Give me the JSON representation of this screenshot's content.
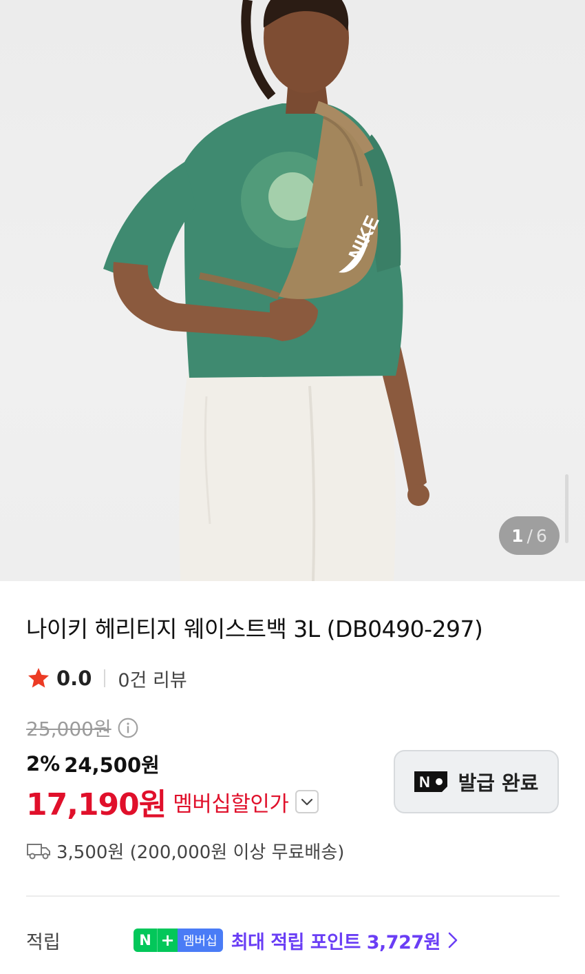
{
  "gallery": {
    "current_page": "1",
    "separator": "/",
    "total_pages": "6"
  },
  "product": {
    "title": "나이키 헤리티지 웨이스트백 3L (DB0490-297)",
    "rating": "0.0",
    "review_count": "0건 리뷰",
    "original_price": "25,000원",
    "sale_rate": "2%",
    "sale_price": "24,500원",
    "member_price": "17,190원",
    "member_price_label": "멤버십할인가",
    "coupon_button_label": "발급 완료",
    "shipping": "3,500원 (200,000원 이상 무료배송)"
  },
  "points": {
    "label": "적립",
    "badge_n": "N",
    "badge_plus": "+",
    "badge_text": "멤버십",
    "text": "최대 적립 포인트 3,727원"
  },
  "colors": {
    "price_red": "#e0102b",
    "points_purple": "#6a3ef5",
    "naver_green": "#03c75a",
    "star_red": "#ec3b24"
  },
  "icons": [
    "star-icon",
    "info-icon",
    "chevron-down-icon",
    "n-logo-icon",
    "truck-icon",
    "chevron-right-icon"
  ]
}
